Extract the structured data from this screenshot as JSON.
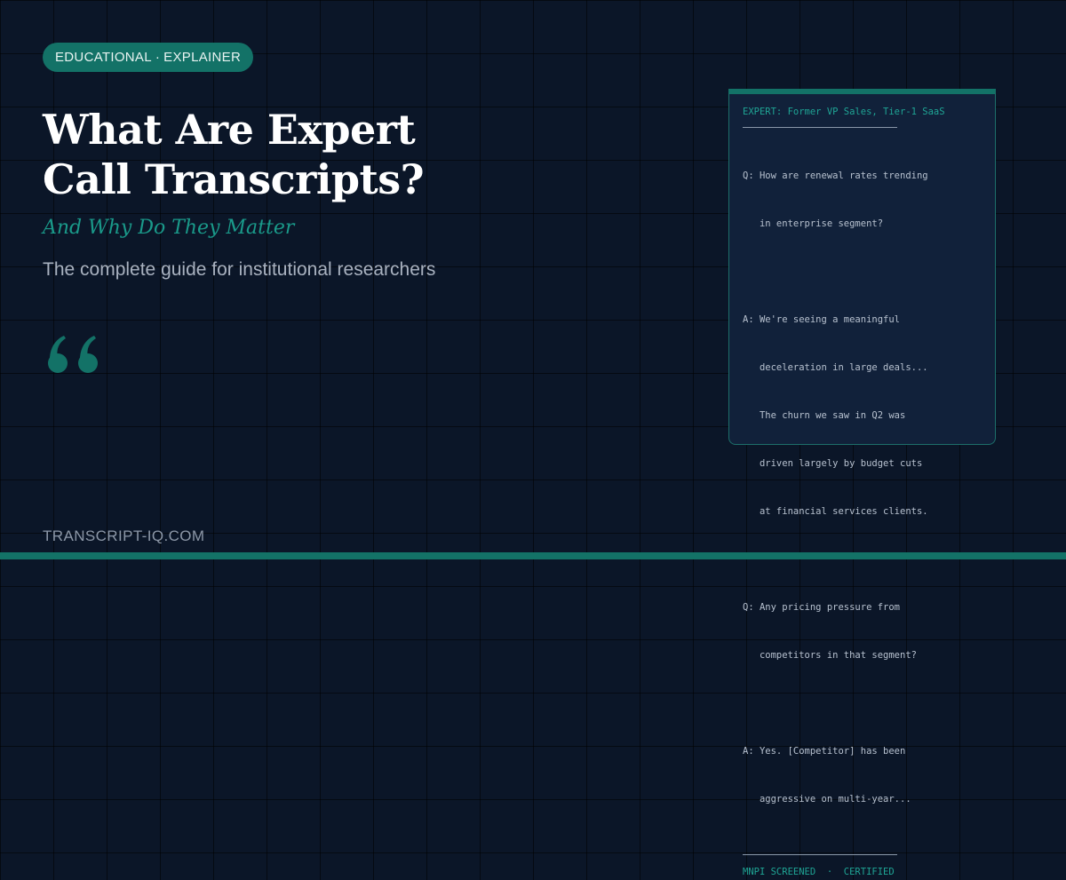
{
  "badge": {
    "left": "EDUCATIONAL",
    "separator": "·",
    "right": "EXPLAINER"
  },
  "title": {
    "line1": "What Are Expert",
    "line2": "Call Transcripts?"
  },
  "subtitle": "And Why Do They Matter",
  "description": "The complete guide for institutional researchers",
  "quote_icon": "open-quote-icon",
  "footer_url": "TRANSCRIPT-IQ.COM",
  "card": {
    "header": "EXPERT: Former VP Sales, Tier-1 SaaS",
    "blocks": [
      {
        "l1": "Q: How are renewal rates trending",
        "l2": "   in enterprise segment?"
      },
      {
        "l1": "A: We're seeing a meaningful",
        "l2": "   deceleration in large deals...",
        "l3": "   The churn we saw in Q2 was",
        "l4": "   driven largely by budget cuts",
        "l5": "   at financial services clients."
      },
      {
        "l1": "Q: Any pricing pressure from",
        "l2": "   competitors in that segment?"
      },
      {
        "l1": "A: Yes. [Competitor] has been",
        "l2": "   aggressive on multi-year..."
      }
    ],
    "footer": "MNPI SCREENED  ·  CERTIFIED"
  },
  "colors": {
    "background": "#0b1628",
    "accent": "#137267",
    "accent_text": "#1a9a8a",
    "card_bg": "#11213a"
  }
}
